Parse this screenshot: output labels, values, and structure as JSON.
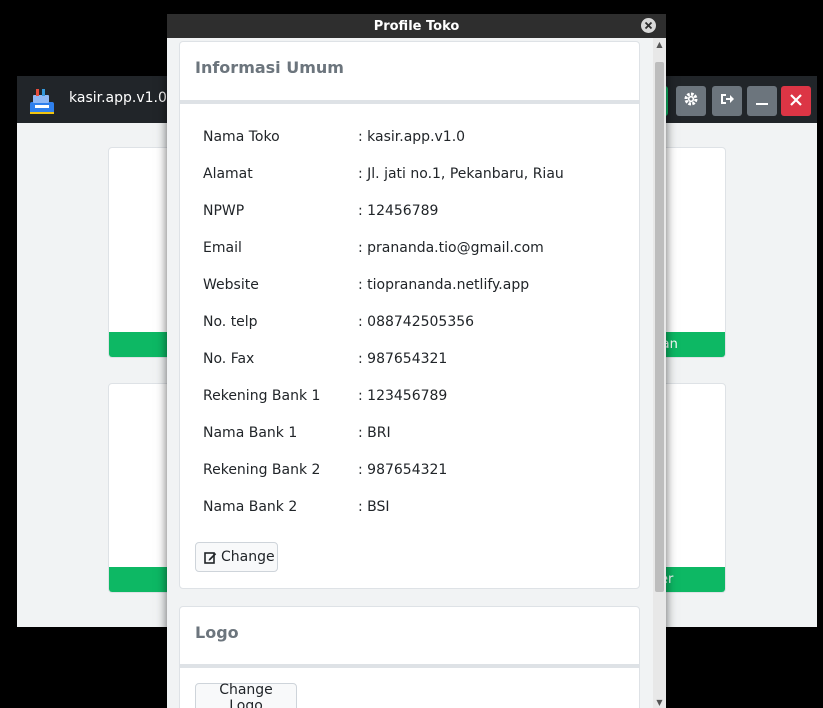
{
  "main_window": {
    "title": "kasir.app.v1.0",
    "card_labels": [
      "lan",
      "er"
    ]
  },
  "dialog": {
    "title": "Profile Toko",
    "general": {
      "heading": "Informasi Umum",
      "rows": [
        {
          "label": "Nama Toko",
          "value": ": kasir.app.v1.0"
        },
        {
          "label": "Alamat",
          "value": ": Jl. jati no.1, Pekanbaru, Riau"
        },
        {
          "label": "NPWP",
          "value": ": 12456789"
        },
        {
          "label": "Email",
          "value": ": prananda.tio@gmail.com"
        },
        {
          "label": "Website",
          "value": ": tioprananda.netlify.app"
        },
        {
          "label": "No. telp",
          "value": ": 088742505356"
        },
        {
          "label": "No. Fax",
          "value": ": 987654321"
        },
        {
          "label": "Rekening Bank 1",
          "value": ": 123456789"
        },
        {
          "label": "Nama Bank 1",
          "value": ": BRI"
        },
        {
          "label": "Rekening Bank 2",
          "value": ": 987654321"
        },
        {
          "label": "Nama Bank 2",
          "value": ": BSI"
        }
      ],
      "change_label": "Change"
    },
    "logo": {
      "heading": "Logo",
      "change_logo_label": "Change Logo"
    }
  },
  "colors": {
    "success": "#0db864",
    "danger": "#dc3545",
    "secondary": "#6c757d",
    "header": "#212529",
    "dialog_titlebar": "#2e2e2e"
  },
  "icons": {
    "app_logo": "cash-register-icon",
    "settings": "gear-icon",
    "logout": "logout-icon",
    "minimize": "minimize-icon",
    "close": "close-icon",
    "dialog_close": "close-circle-icon",
    "edit": "edit-icon"
  }
}
